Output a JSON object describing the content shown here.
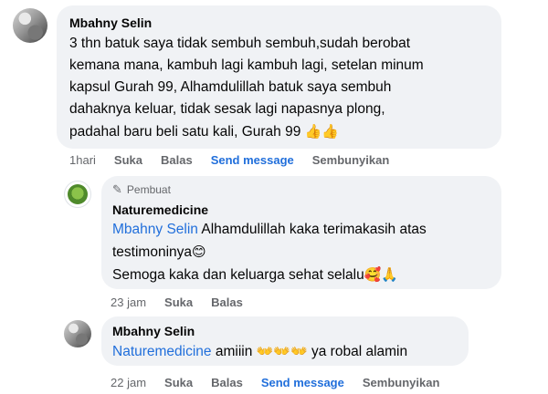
{
  "comment1": {
    "author": "Mbahny Selin",
    "lines": [
      "3 thn batuk saya tidak sembuh sembuh,sudah berobat",
      "kemana mana, kambuh lagi kambuh lagi, setelan minum",
      "kapsul Gurah 99, Alhamdulillah batuk saya sembuh",
      "dahaknya keluar, tidak sesak lagi napasnya plong,",
      "padahal baru beli satu kali, Gurah 99"
    ],
    "emoji": "👍👍",
    "time": "1hari",
    "actions": [
      "Suka",
      "Balas",
      "Send message",
      "Sembunyikan"
    ]
  },
  "reply1": {
    "badge": "Pembuat",
    "badge_icon": "pencil-icon",
    "author": "Naturemedicine",
    "mention": "Mbahny Selin",
    "line1_rest": " Alhamdulillah kaka terimakasih atas",
    "line2": "testimoninya",
    "line2_emoji": "😊",
    "line3": "Semoga kaka dan keluarga sehat selalu",
    "line3_emoji": "🥰🙏",
    "time": "23 jam",
    "actions": [
      "Suka",
      "Balas"
    ]
  },
  "reply2": {
    "author": "Mbahny Selin",
    "mention": "Naturemedicine",
    "text_a": " amiiin ",
    "emoji": "👐👐👐",
    "text_b": " ya robal alamin",
    "time": "22 jam",
    "actions": [
      "Suka",
      "Balas",
      "Send message",
      "Sembunyikan"
    ]
  }
}
